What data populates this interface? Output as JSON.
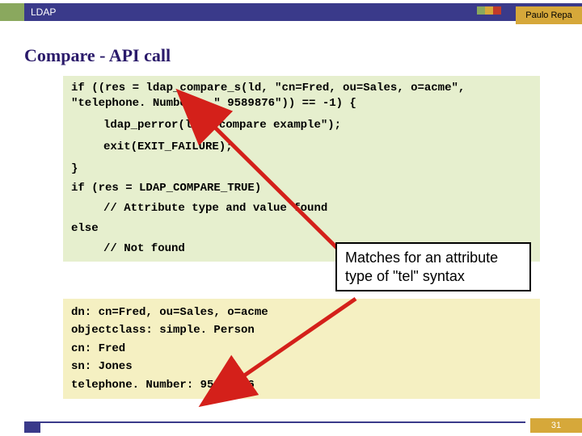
{
  "header": {
    "category": "LDAP",
    "author": "Paulo Repa",
    "colors": [
      "#8aa85e",
      "#d6a83a",
      "#c03a2a",
      "#3a3a8a"
    ]
  },
  "title": "Compare - API call",
  "code": {
    "l1": "if ((res = ldap_compare_s(ld, \"cn=Fred, ou=Sales, o=acme\",",
    "l2": "\"telephone. Number\", \" 9589876\")) == -1) {",
    "l3": "ldap_perror(ld, \"compare example\");",
    "l4": "exit(EXIT_FAILURE);",
    "l5": "}",
    "l6": "if (res = LDAP_COMPARE_TRUE)",
    "l7": "// Attribute type and value found",
    "l8": "else",
    "l9": "// Not found"
  },
  "ldif": {
    "l1": "dn: cn=Fred, ou=Sales, o=acme",
    "l2": "objectclass: simple. Person",
    "l3": "cn: Fred",
    "l4": "sn: Jones",
    "l5": "telephone. Number: 958-9876"
  },
  "callout": "Matches for an attribute type of \"tel\" syntax",
  "page_number": "31"
}
